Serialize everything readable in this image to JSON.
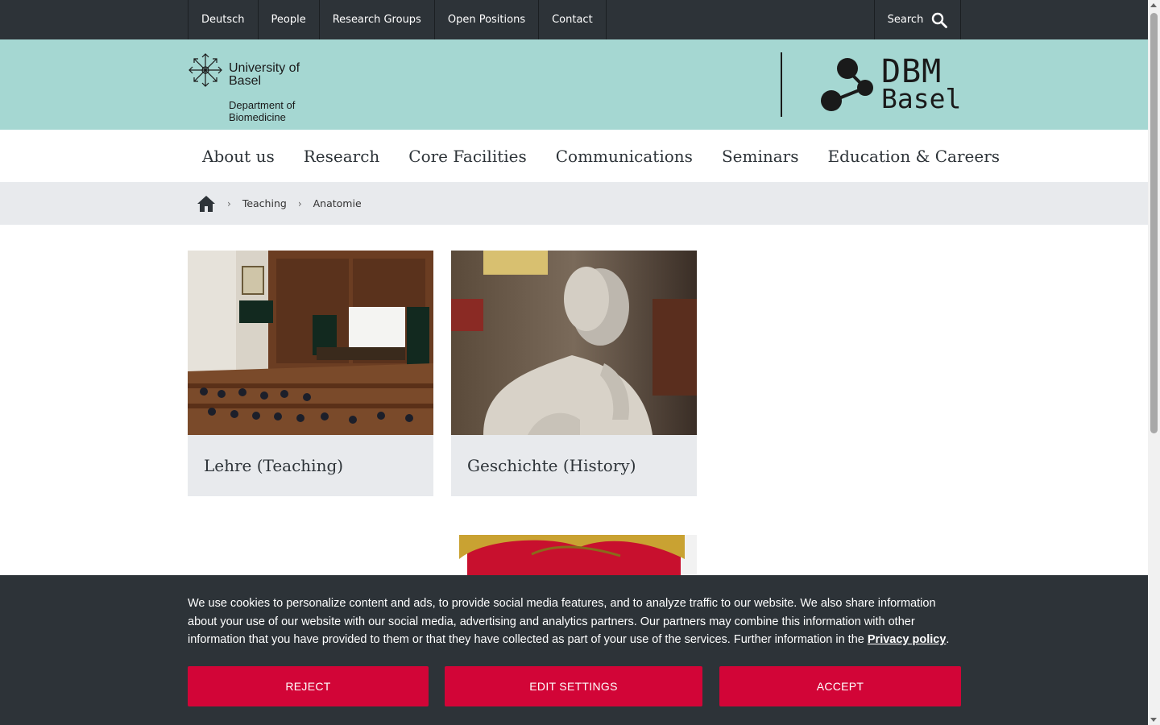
{
  "topbar": {
    "links": [
      "Deutsch",
      "People",
      "Research Groups",
      "Open Positions",
      "Contact"
    ],
    "search_label": "Search"
  },
  "header": {
    "university_name": "University of Basel",
    "department": "Department of Biomedicine",
    "dbm_logo_line1": "DBM",
    "dbm_logo_line2": "Basel",
    "colors": {
      "band": "#a5d7d2",
      "topbar": "#2d3338"
    }
  },
  "mainnav": {
    "items": [
      "About us",
      "Research",
      "Core Facilities",
      "Communications",
      "Seminars",
      "Education & Careers"
    ]
  },
  "breadcrumb": {
    "items": [
      "Teaching",
      "Anatomie"
    ]
  },
  "cards": [
    {
      "title": "Lehre (Teaching)"
    },
    {
      "title": "Geschichte (History)"
    }
  ],
  "cookie": {
    "text": "We use cookies to personalize content and ads, to provide social media features, and to analyze traffic to our website. We also share information about your use of our website with our social media, advertising and analytics partners. Our partners may combine this information with other information that you have provided to them or that they have collected as part of your use of the services. Further information in the ",
    "privacy_link": "Privacy policy",
    "period": ".",
    "reject": "REJECT",
    "edit": "EDIT SETTINGS",
    "accept": "ACCEPT",
    "button_color": "#d20537"
  }
}
